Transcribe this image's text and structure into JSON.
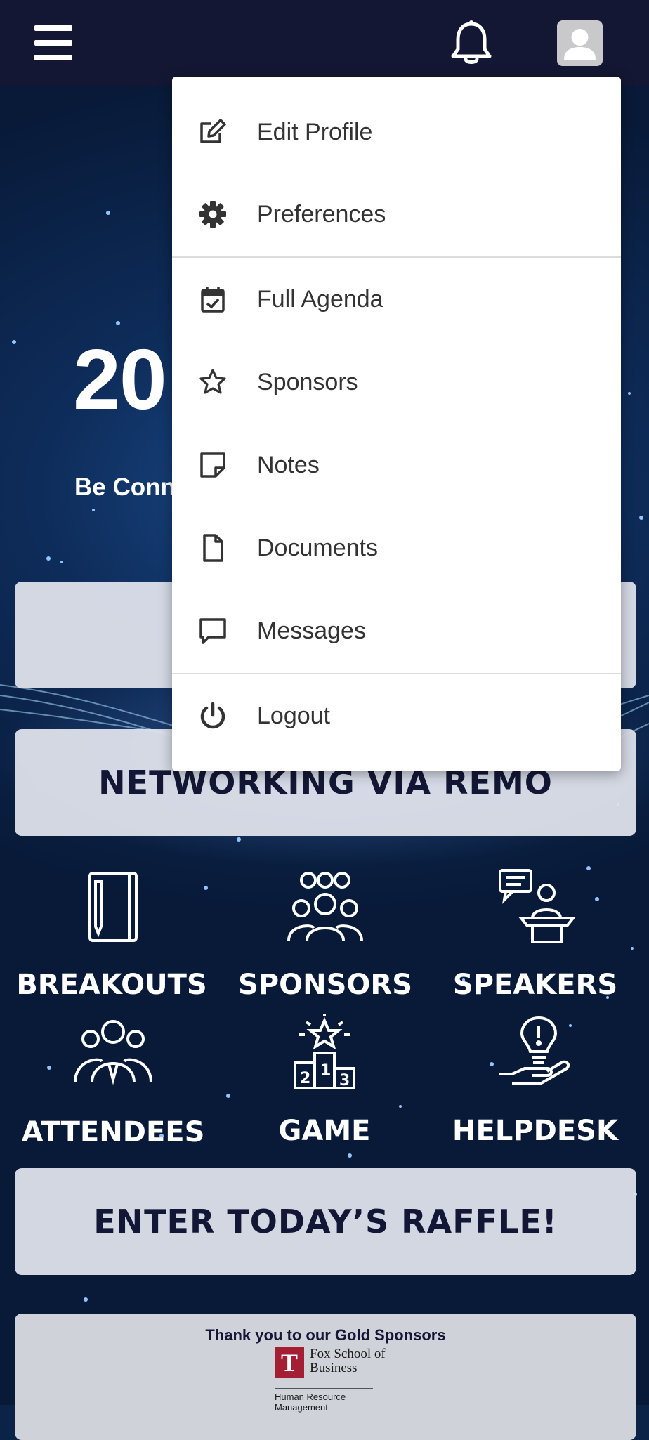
{
  "header": {
    "menu_icon": "hamburger-icon",
    "notification_icon": "bell-icon",
    "profile_icon": "user-avatar-icon"
  },
  "hero": {
    "year_partial": "20",
    "tagline_partial": "Be Conn"
  },
  "dropdown": {
    "items": [
      {
        "label": "Edit Profile",
        "icon": "edit-icon"
      },
      {
        "label": "Preferences",
        "icon": "gear-icon"
      },
      {
        "label": "Full Agenda",
        "icon": "calendar-check-icon"
      },
      {
        "label": "Sponsors",
        "icon": "star-icon"
      },
      {
        "label": "Notes",
        "icon": "note-icon"
      },
      {
        "label": "Documents",
        "icon": "document-icon"
      },
      {
        "label": "Messages",
        "icon": "message-icon"
      },
      {
        "label": "Logout",
        "icon": "power-icon"
      }
    ]
  },
  "banners": {
    "networking": "NETWORKING VIA REMO",
    "raffle": "ENTER TODAY’S RAFFLE!"
  },
  "tiles": [
    {
      "label": "BREAKOUTS",
      "icon": "notebook-icon"
    },
    {
      "label": "SPONSORS",
      "icon": "group-icon"
    },
    {
      "label": "SPEAKERS",
      "icon": "podium-speaker-icon"
    },
    {
      "label": "ATTENDEES",
      "icon": "attendees-icon"
    },
    {
      "label": "GAME",
      "icon": "trophy-podium-icon"
    },
    {
      "label": "HELPDESK",
      "icon": "lightbulb-hand-icon"
    }
  ],
  "sponsors_section": {
    "heading": "Thank you to our Gold Sponsors",
    "logo_mark": "T",
    "logo_name": "Fox School of Business",
    "logo_sub": "Human Resource Management"
  },
  "colors": {
    "header_bg": "#141733",
    "banner_bg": "#dee2eb",
    "banner_text": "#131735",
    "menu_bg": "#ffffff",
    "menu_text": "#333333"
  }
}
